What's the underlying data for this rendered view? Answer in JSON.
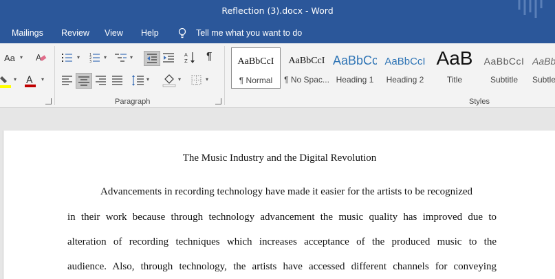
{
  "window": {
    "title": "Reflection (3).docx  -  Word"
  },
  "menu": {
    "items": [
      "Mailings",
      "Review",
      "View",
      "Help"
    ],
    "tell_me": "Tell me what you want to do"
  },
  "ribbon": {
    "font_group": {
      "font_size_label": "Aa"
    },
    "paragraph_group": {
      "label": "Paragraph"
    },
    "styles_group": {
      "label": "Styles",
      "items": [
        {
          "sample": "AaBbCcI",
          "name": "¶ Normal"
        },
        {
          "sample": "AaBbCcI",
          "name": "¶ No Spac..."
        },
        {
          "sample": "AaBbCc",
          "name": "Heading 1"
        },
        {
          "sample": "AaBbCcI",
          "name": "Heading 2"
        },
        {
          "sample": "AaB",
          "name": "Title"
        },
        {
          "sample": "AaBbCcI",
          "name": "Subtitle"
        },
        {
          "sample": "AaBb",
          "name": "Subtle"
        }
      ]
    }
  },
  "colors": {
    "accent": "#2b579a",
    "highlight": "#ffff00",
    "font_color": "#c00000"
  },
  "document": {
    "title": "The Music Industry and the Digital Revolution",
    "lines": [
      "Advancements in recording technology have made it easier for the artists to be recognized",
      "in their work because through technology advancement the music quality has improved due to",
      "alteration of recording techniques which increases acceptance of the produced music to the",
      "audience. Also, through technology, the artists have accessed different channels for conveying"
    ]
  }
}
